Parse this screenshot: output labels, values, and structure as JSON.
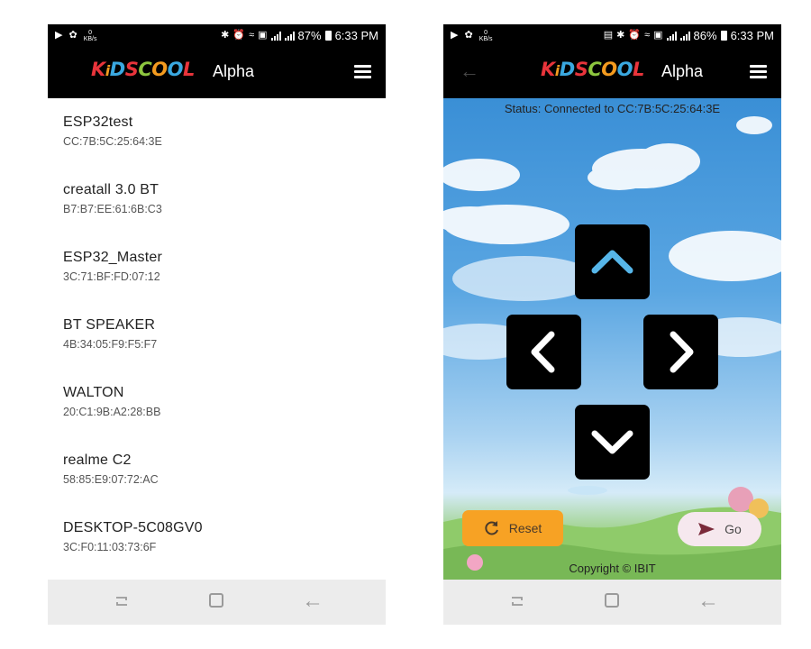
{
  "left_screen": {
    "status_bar": {
      "battery": "87%",
      "time": "6:33 PM",
      "net_speed": "0",
      "net_unit": "KB/s"
    },
    "app_bar": {
      "logo_text": "KiDSCOOL",
      "title": "Alpha"
    },
    "devices": [
      {
        "name": "ESP32test",
        "mac": "CC:7B:5C:25:64:3E"
      },
      {
        "name": "creatall 3.0 BT",
        "mac": "B7:B7:EE:61:6B:C3"
      },
      {
        "name": "ESP32_Master",
        "mac": "3C:71:BF:FD:07:12"
      },
      {
        "name": "BT SPEAKER",
        "mac": "4B:34:05:F9:F5:F7"
      },
      {
        "name": "WALTON",
        "mac": "20:C1:9B:A2:28:BB"
      },
      {
        "name": "realme C2",
        "mac": "58:85:E9:07:72:AC"
      },
      {
        "name": "DESKTOP-5C08GV0",
        "mac": "3C:F0:11:03:73:6F"
      }
    ]
  },
  "right_screen": {
    "status_bar": {
      "battery": "86%",
      "time": "6:33 PM",
      "net_speed": "0",
      "net_unit": "KB/s"
    },
    "app_bar": {
      "logo_text": "KiDSCOOL",
      "title": "Alpha"
    },
    "status": "Status: Connected to CC:7B:5C:25:64:3E",
    "reset_label": "Reset",
    "go_label": "Go",
    "copyright": "Copyright © IBIT"
  },
  "colors": {
    "app_bar_bg": "#000000",
    "reset_button": "#f7a224",
    "go_button": "#f6e8ee",
    "nav_bar": "#ececec",
    "logo_letters": [
      "#e8343b",
      "#f39b1f",
      "#3aa8e0",
      "#e8343b",
      "#8dc63f",
      "#f39b1f",
      "#3aa8e0",
      "#e8343b"
    ]
  },
  "icons": {
    "status_left": [
      "play-icon",
      "settings-icon",
      "network-speed-icon"
    ],
    "status_right_left_screen": [
      "bluetooth-icon",
      "alarm-icon",
      "wifi-icon",
      "nfc-icon",
      "signal-icon",
      "signal-icon",
      "battery-icon"
    ],
    "status_right_right_screen": [
      "cast-icon",
      "bluetooth-icon",
      "alarm-icon",
      "wifi-icon",
      "nfc-icon",
      "signal-icon",
      "signal-icon",
      "battery-icon"
    ],
    "app_bar": [
      "back-arrow-icon",
      "menu-icon"
    ],
    "dpad": [
      "up-arrow-icon",
      "left-arrow-icon",
      "right-arrow-icon",
      "down-arrow-icon"
    ],
    "buttons": [
      "reset-icon",
      "send-icon"
    ],
    "nav": [
      "recent-apps-icon",
      "home-icon",
      "back-icon"
    ]
  }
}
